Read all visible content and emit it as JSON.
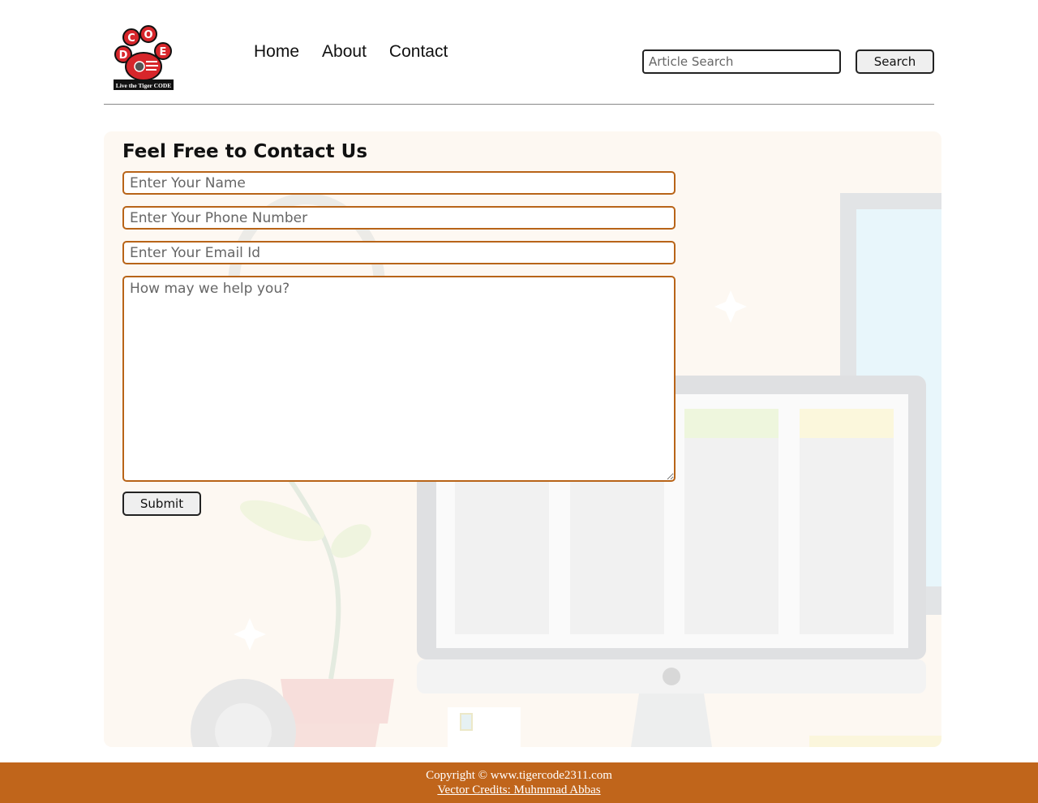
{
  "header": {
    "logo": {
      "letters": [
        "C",
        "O",
        "D",
        "E"
      ],
      "tagline": "Live the Tiger CODE",
      "colors": {
        "paw": "#d7262b",
        "outline": "#111111",
        "pad": "#ffffff"
      }
    },
    "nav": [
      {
        "label": "Home"
      },
      {
        "label": "About"
      },
      {
        "label": "Contact"
      }
    ],
    "search": {
      "placeholder": "Article Search",
      "value": "",
      "button_label": "Search"
    }
  },
  "contact_form": {
    "title": "Feel Free to Contact Us",
    "name_placeholder": "Enter Your Name",
    "phone_placeholder": "Enter Your Phone Number",
    "email_placeholder": "Enter Your Email Id",
    "message_placeholder": "How may we help you?",
    "submit_label": "Submit",
    "field_border_color": "#b86418",
    "panel_color": "#fdf8f2"
  },
  "footer": {
    "copyright": "Copyright © www.tigercode2311.com",
    "credits_link": "Vector Credits: Muhmmad Abbas",
    "background_color": "#c0651b"
  }
}
